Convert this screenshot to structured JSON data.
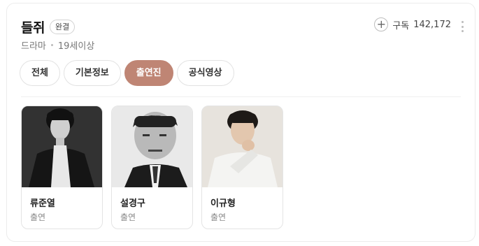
{
  "header": {
    "title": "들쥐",
    "status_badge": "완결",
    "genre": "드라마",
    "rating": "19세이상",
    "subscribe_label": "구독",
    "subscribe_count": "142,172"
  },
  "tabs": [
    {
      "label": "전체",
      "active": false
    },
    {
      "label": "기본정보",
      "active": false
    },
    {
      "label": "출연진",
      "active": true
    },
    {
      "label": "공식영상",
      "active": false
    }
  ],
  "cast": [
    {
      "name": "류준열",
      "role": "출연"
    },
    {
      "name": "설경구",
      "role": "출연"
    },
    {
      "name": "이규형",
      "role": "출연"
    }
  ],
  "colors": {
    "accent": "#bf8574"
  }
}
